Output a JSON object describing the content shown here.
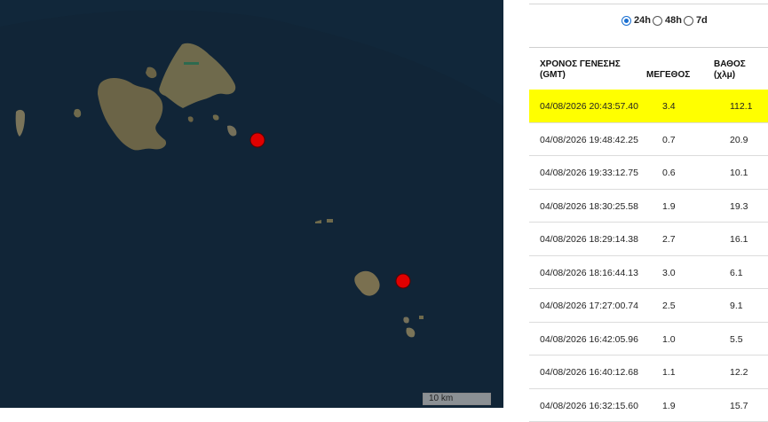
{
  "map": {
    "scale_label": "10 km",
    "marker_color": "#e00000"
  },
  "filter": {
    "options": [
      "24h",
      "48h",
      "7d"
    ],
    "selected": "24h"
  },
  "table": {
    "headers": {
      "time": [
        "ΧΡΟΝΟΣ ΓΕΝΕΣΗΣ",
        "(GMT)"
      ],
      "magnitude": [
        "ΜΕΓΕΘΟΣ"
      ],
      "depth": [
        "ΒΑΘΟΣ",
        "(χλμ)"
      ]
    },
    "highlight_color": "#ffff00",
    "rows": [
      {
        "time": "04/08/2026 20:43:57.40",
        "mag": "3.4",
        "depth": "112.1",
        "highlighted": true
      },
      {
        "time": "04/08/2026 19:48:42.25",
        "mag": "0.7",
        "depth": "20.9"
      },
      {
        "time": "04/08/2026 19:33:12.75",
        "mag": "0.6",
        "depth": "10.1"
      },
      {
        "time": "04/08/2026 18:30:25.58",
        "mag": "1.9",
        "depth": "19.3"
      },
      {
        "time": "04/08/2026 18:29:14.38",
        "mag": "2.7",
        "depth": "16.1"
      },
      {
        "time": "04/08/2026 18:16:44.13",
        "mag": "3.0",
        "depth": "6.1"
      },
      {
        "time": "04/08/2026 17:27:00.74",
        "mag": "2.5",
        "depth": "9.1"
      },
      {
        "time": "04/08/2026 16:42:05.96",
        "mag": "1.0",
        "depth": "5.5"
      },
      {
        "time": "04/08/2026 16:40:12.68",
        "mag": "1.1",
        "depth": "12.2"
      },
      {
        "time": "04/08/2026 16:32:15.60",
        "mag": "1.9",
        "depth": "15.7"
      }
    ]
  }
}
